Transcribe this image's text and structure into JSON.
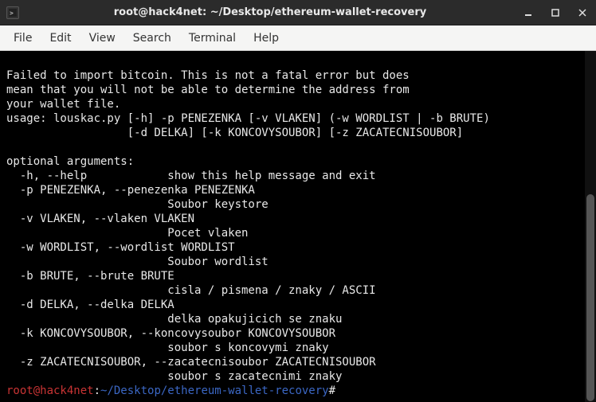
{
  "window": {
    "title": "root@hack4net: ~/Desktop/ethereum-wallet-recovery"
  },
  "menu": {
    "file": "File",
    "edit": "Edit",
    "view": "View",
    "search": "Search",
    "terminal": "Terminal",
    "help": "Help"
  },
  "terminal": {
    "blank": "",
    "l1": "Failed to import bitcoin. This is not a fatal error but does",
    "l2": "mean that you will not be able to determine the address from",
    "l3": "your wallet file.",
    "l4": "usage: louskac.py [-h] -p PENEZENKA [-v VLAKEN] (-w WORDLIST | -b BRUTE)",
    "l5": "                  [-d DELKA] [-k KONCOVYSOUBOR] [-z ZACATECNISOUBOR]",
    "l6": "",
    "l7": "optional arguments:",
    "l8": "  -h, --help            show this help message and exit",
    "l9": "  -p PENEZENKA, --penezenka PENEZENKA",
    "l10": "                        Soubor keystore",
    "l11": "  -v VLAKEN, --vlaken VLAKEN",
    "l12": "                        Pocet vlaken",
    "l13": "  -w WORDLIST, --wordlist WORDLIST",
    "l14": "                        Soubor wordlist",
    "l15": "  -b BRUTE, --brute BRUTE",
    "l16": "                        cisla / pismena / znaky / ASCII",
    "l17": "  -d DELKA, --delka DELKA",
    "l18": "                        delka opakujicich se znaku",
    "l19": "  -k KONCOVYSOUBOR, --koncovysoubor KONCOVYSOUBOR",
    "l20": "                        soubor s koncovymi znaky",
    "l21": "  -z ZACATECNISOUBOR, --zacatecnisoubor ZACATECNISOUBOR",
    "l22": "                        soubor s zacatecnimi znaky"
  },
  "prompt": {
    "user": "root@hack4net",
    "colon": ":",
    "path": "~/Desktop/ethereum-wallet-recovery",
    "sigil": "#"
  }
}
